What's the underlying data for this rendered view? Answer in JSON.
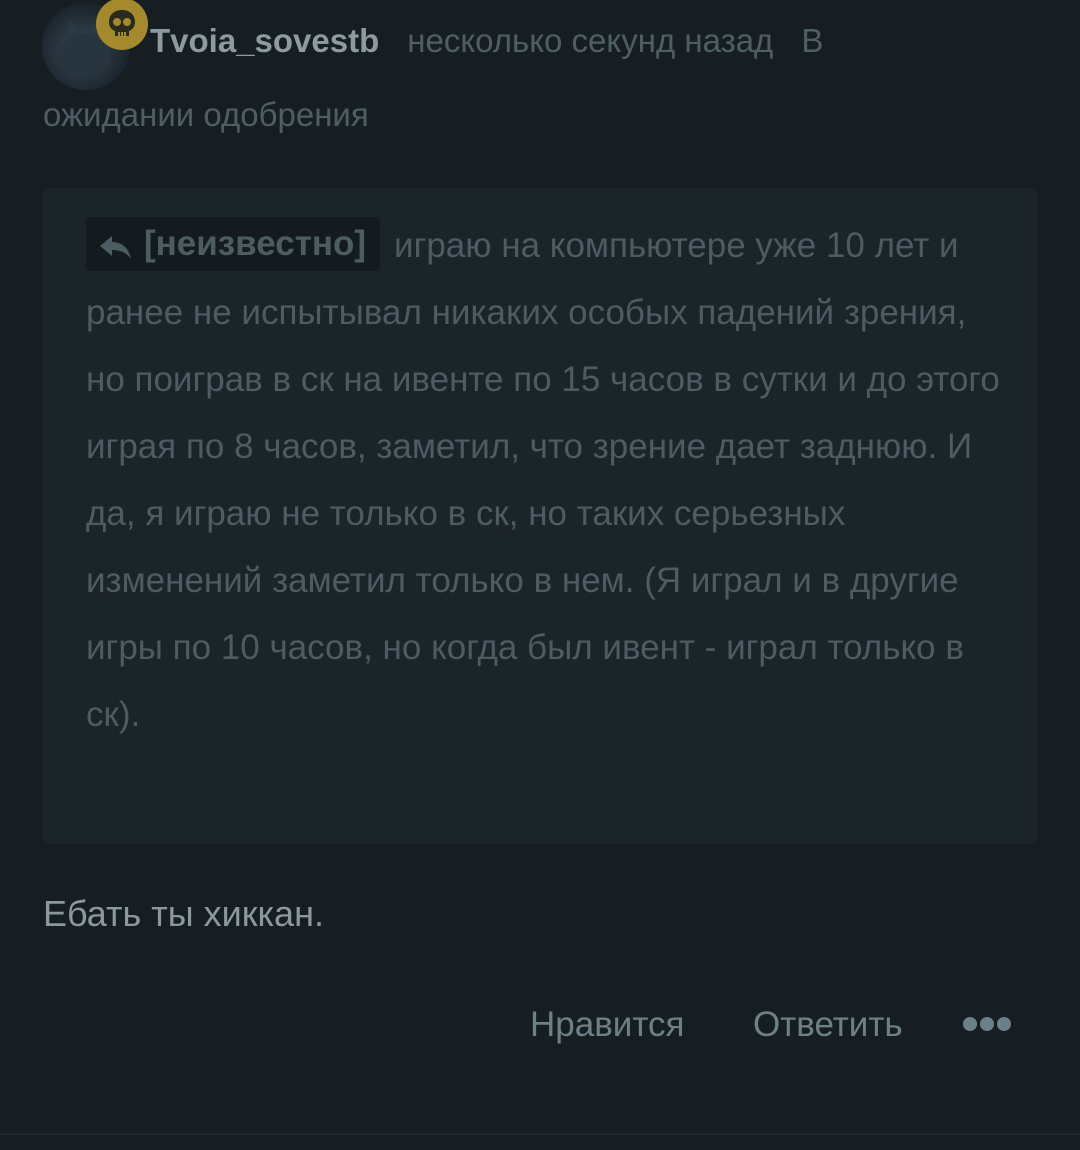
{
  "comment": {
    "author": "Tvoia_sovestb",
    "time": "несколько секунд назад",
    "status_part1": "В",
    "status_part2": "ожидании одобрения",
    "badge_icon": "skull-icon",
    "badge_color": "#a48a2c",
    "quote": {
      "reply_to": "[неизвестно]",
      "reply_icon": "reply-arrow-icon",
      "text": "играю на компьютере уже 10 лет и ранее не испытывал никаких особых падений зрения, но поиграв в ск на ивенте по 15 часов в сутки и до этого играя по 8 часов, заметил, что зрение дает заднюю. И да, я играю не только в ск, но таких серьезных изменений заметил только в нем. (Я играл и в другие игры по 10 часов, но когда был ивент - играл только в ск)."
    },
    "body": "Ебать ты хиккан.",
    "actions": {
      "like": "Нравится",
      "reply": "Ответить",
      "more_icon": "more-dots-icon"
    }
  }
}
